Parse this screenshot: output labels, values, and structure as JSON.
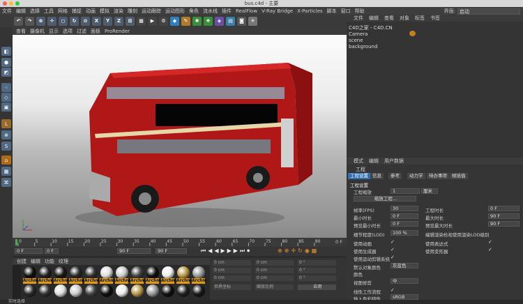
{
  "window": {
    "title": "bus.c4d - 主要"
  },
  "menu": [
    "文件",
    "编辑",
    "选择",
    "工具",
    "网格",
    "捕捉",
    "动画",
    "模拟",
    "渲染",
    "雕刻",
    "运动跟踪",
    "运动图形",
    "角色",
    "流水线",
    "插件",
    "RealFlow",
    "V-Ray Bridge",
    "X-Particles",
    "脚本",
    "窗口",
    "帮助"
  ],
  "interface": {
    "label": "界面:",
    "value": "启动"
  },
  "viewport_menu": [
    "查看",
    "摄像机",
    "显示",
    "选项",
    "过滤",
    "面板",
    "ProRender"
  ],
  "timeline": {
    "ticks": [
      "0",
      "5",
      "10",
      "15",
      "20",
      "25",
      "30",
      "35",
      "40",
      "45",
      "50",
      "55",
      "60",
      "65",
      "70",
      "75",
      "80",
      "85",
      "90"
    ],
    "end_label": "0 F"
  },
  "playback": {
    "start": "0 F",
    "current": "0 F",
    "end1": "90 F",
    "end2": "90 F"
  },
  "material_menu": [
    "创建",
    "编辑",
    "功能",
    "纹理"
  ],
  "material_label": "Archm",
  "coords": {
    "rows": [
      [
        "0 cm",
        "0 cm",
        "0 °"
      ],
      [
        "0 cm",
        "0 cm",
        "0 °"
      ],
      [
        "0 cm",
        "0 cm",
        "0 °"
      ]
    ],
    "world_label": "世界坐标",
    "scale_label": "缩放比例",
    "apply_label": "应用"
  },
  "object_menu": [
    "文件",
    "编辑",
    "查看",
    "对象",
    "标签",
    "书签"
  ],
  "objects": [
    {
      "name": "C4D之家 - C4D.CN"
    },
    {
      "name": "Camera"
    },
    {
      "name": "scene"
    },
    {
      "name": "background"
    }
  ],
  "attr_menu": [
    "模式",
    "编辑",
    "用户数据"
  ],
  "attr_title": "工程",
  "attr_tabs": [
    "工程设置",
    "信息",
    "参考",
    "动力学",
    "待办事项",
    "帧插值"
  ],
  "attr_section": "工程设置",
  "attr": {
    "scale_label": "工程缩放",
    "scale_value": "1",
    "scale_unit": "厘米",
    "scale_btn": "缩放工程...",
    "fps_label": "帧率(FPS)",
    "fps_value": "30",
    "duration_label": "工程时长",
    "duration_value": "0 F",
    "min_label": "最小时长",
    "min_value": "0 F",
    "max_label": "最大时长",
    "max_value": "90 F",
    "pmin_label": "预览最小时长",
    "pmin_value": "0 F",
    "pmax_label": "预览最大时长",
    "pmax_value": "90 F",
    "lod_label": "细节程度(LOD)",
    "lod_value": "100 %",
    "lod_note": "编辑渲染检视使用渲染LOD级别",
    "anim_label": "使用动画",
    "expr_label": "使用表达式",
    "gen_label": "使用生成器",
    "deform_label": "使用变形器",
    "motion_label": "使用运动剪辑系统",
    "color_label": "默认对象颜色",
    "color_value": "灰蓝色",
    "color2_label": "颜色",
    "clip_label": "视图修剪",
    "clip_value": "中",
    "linear_label": "线性工作流程",
    "input_label": "输入色彩特性",
    "input_value": "sRGB"
  },
  "status": "实时选择"
}
